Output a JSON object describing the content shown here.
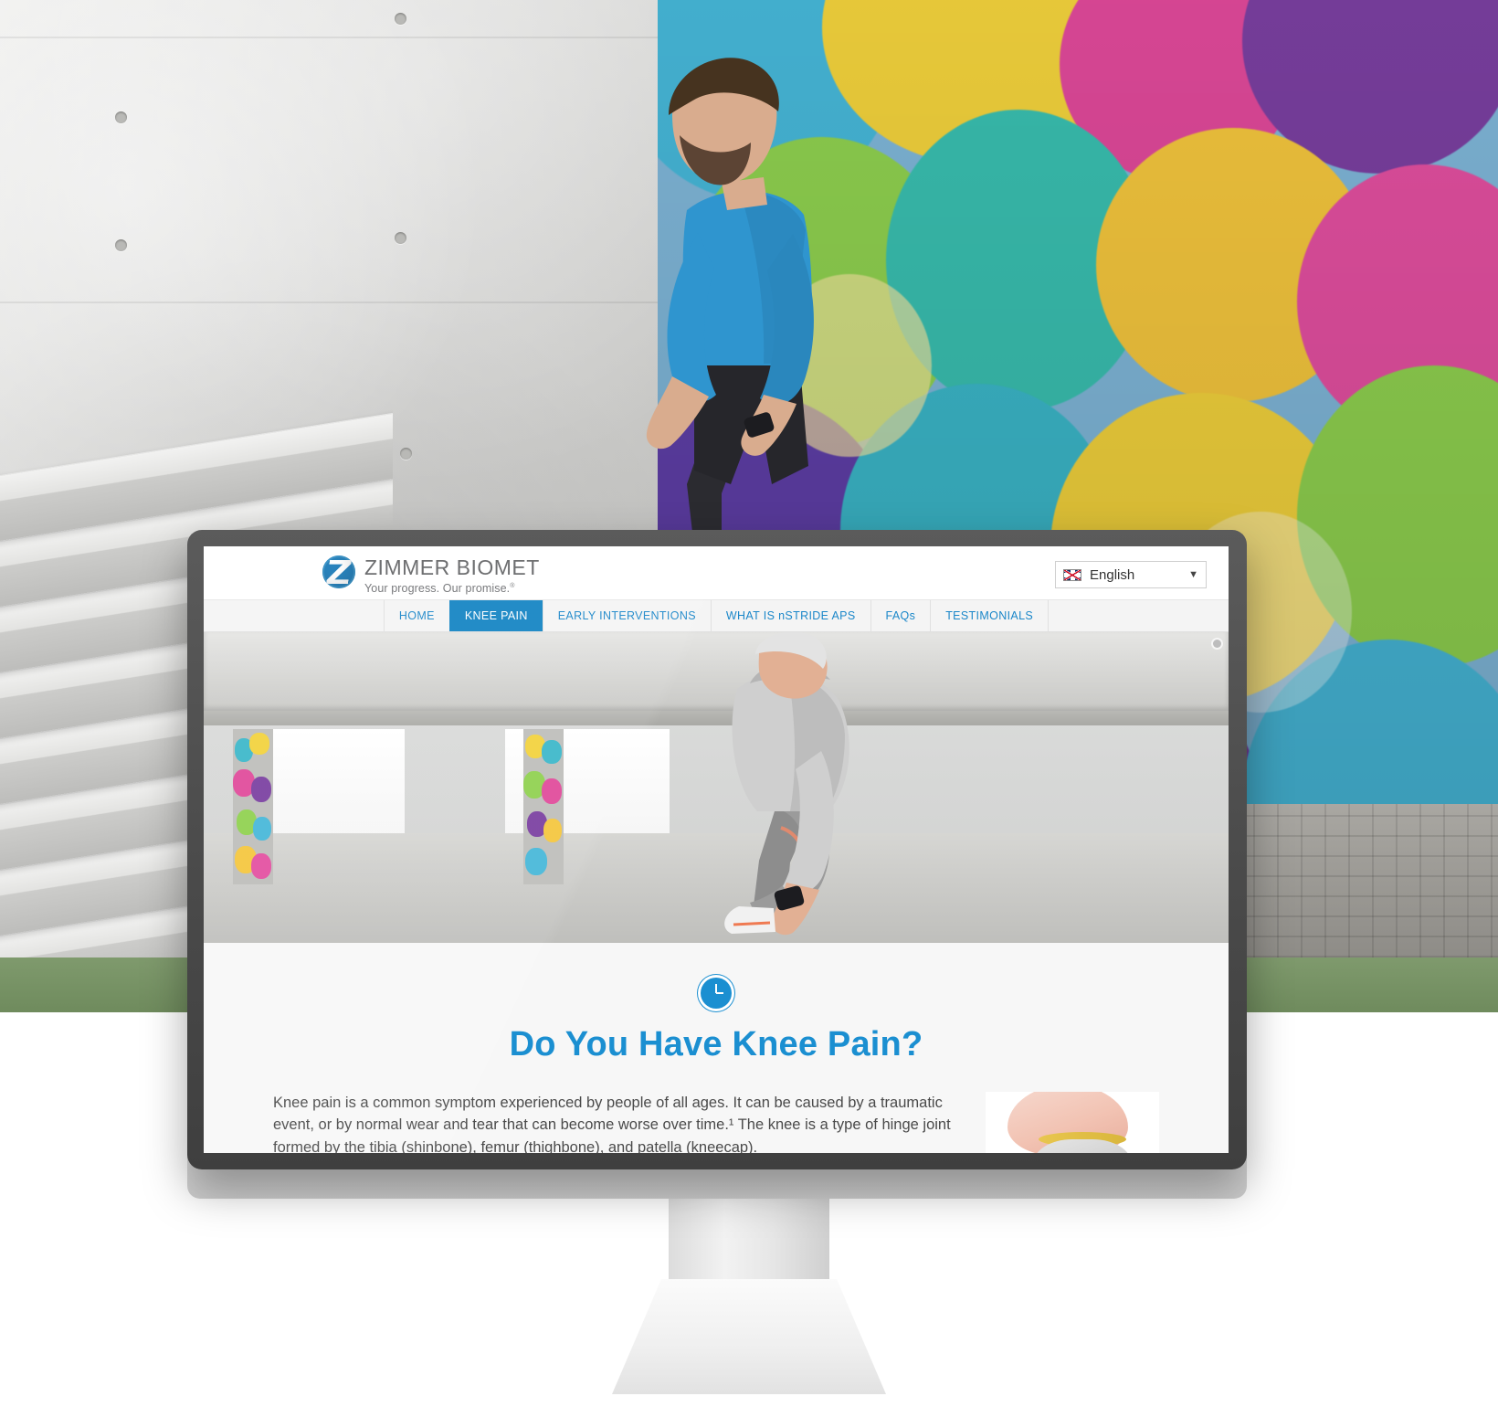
{
  "scene": {
    "device": "imac-desktop-monitor",
    "background_description": "Runner on steps beside colorful mural wall"
  },
  "site": {
    "brand": {
      "name": "ZIMMER BIOMET",
      "tagline": "Your progress. Our promise.",
      "tagline_sup": "®",
      "logo_icon": "zimmer-biomet-z-logo"
    },
    "language_selector": {
      "value": "English",
      "flag_icon": "uk-flag-icon",
      "caret_icon": "chevron-down-icon"
    },
    "nav": [
      {
        "label": "HOME",
        "active": false
      },
      {
        "label": "KNEE PAIN",
        "active": true
      },
      {
        "label": "EARLY INTERVENTIONS",
        "active": false
      },
      {
        "label": "WHAT IS nSTRIDE APS",
        "active": false
      },
      {
        "label": "FAQs",
        "active": false
      },
      {
        "label": "TESTIMONIALS",
        "active": false
      }
    ],
    "hero": {
      "alt": "Woman tying running shoe in concrete parking garage with graffiti pillars",
      "badge_icon": "slider-dot-icon"
    },
    "content": {
      "icon": "clock-icon",
      "title": "Do You Have Knee Pain?",
      "paragraph": "Knee pain is a common symptom experienced by people of all ages. It can be caused by a traumatic event, or by normal wear and tear that can become worse over time.¹ The knee is a type of hinge joint formed by the tibia (shinbone), femur (thighbone), and patella (kneecap).",
      "figure_alt": "Illustration of knee joint anatomy"
    }
  },
  "colors": {
    "brand_blue": "#1b8fd1",
    "nav_active": "#1283c3",
    "nav_link": "#1b87c9",
    "nav_bg": "#f4f4f4",
    "bezel": "#4a4a4a",
    "content_bg": "#f7f7f7",
    "body_text": "#4a4a4a",
    "brand_grey": "#636466"
  }
}
